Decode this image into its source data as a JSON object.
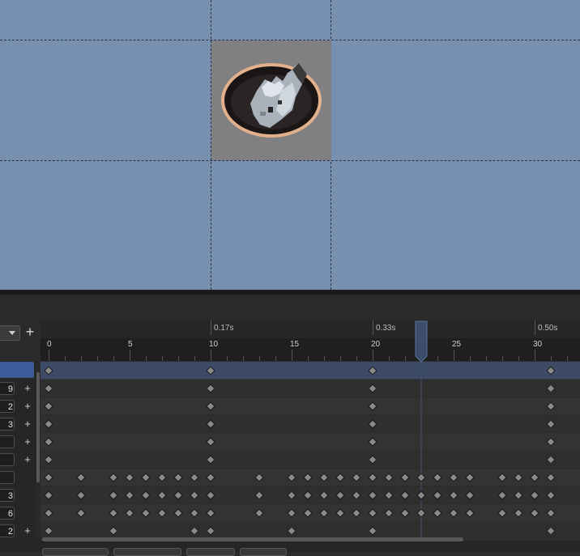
{
  "timeline": {
    "time_markers": [
      {
        "label": "0.17s",
        "frame": 10
      },
      {
        "label": "0.33s",
        "frame": 20
      },
      {
        "label": "0.50s",
        "frame": 30
      }
    ],
    "frame_ticks": [
      0,
      5,
      10,
      15,
      20,
      25,
      30
    ],
    "playhead_frame": 23,
    "rows": [
      {
        "keys": [
          0,
          10,
          20,
          31
        ],
        "selected": true
      },
      {
        "keys": [
          0,
          10,
          20,
          31
        ]
      },
      {
        "keys": [
          0,
          10,
          20,
          31
        ]
      },
      {
        "keys": [
          0,
          10,
          20,
          31
        ]
      },
      {
        "keys": [
          0,
          10,
          20,
          31
        ]
      },
      {
        "keys": [
          0,
          10,
          20,
          31
        ]
      },
      {
        "keys": [
          0,
          2,
          4,
          5,
          6,
          7,
          8,
          9,
          10,
          13,
          15,
          16,
          17,
          18,
          19,
          20,
          21,
          22,
          23,
          24,
          25,
          26,
          28,
          29,
          30,
          31
        ]
      },
      {
        "keys": [
          0,
          2,
          4,
          5,
          6,
          7,
          8,
          9,
          10,
          13,
          15,
          16,
          17,
          18,
          19,
          20,
          21,
          22,
          23,
          24,
          25,
          26,
          28,
          29,
          30,
          31
        ]
      },
      {
        "keys": [
          0,
          2,
          4,
          5,
          6,
          7,
          8,
          9,
          10,
          13,
          15,
          16,
          17,
          18,
          19,
          20,
          21,
          22,
          23,
          24,
          25,
          26,
          28,
          29,
          30,
          31
        ]
      },
      {
        "keys": [
          0,
          4,
          9,
          10,
          15,
          20,
          31
        ]
      }
    ]
  },
  "tracks": [
    {
      "value": "",
      "plus": false,
      "selected": true
    },
    {
      "value": "9",
      "plus": true
    },
    {
      "value": "2",
      "plus": true
    },
    {
      "value": "3",
      "plus": true
    },
    {
      "value": "",
      "plus": true
    },
    {
      "value": "",
      "plus": true
    },
    {
      "value": "",
      "plus": false
    },
    {
      "value": "3",
      "plus": false
    },
    {
      "value": "6",
      "plus": false
    },
    {
      "value": "2",
      "plus": true
    }
  ],
  "toolbar": {
    "add_label": "+"
  },
  "colors": {
    "viewport_bg": "#7890b0",
    "sprite_bg": "#808080",
    "selected_row": "#3d4b66",
    "playhead": "#3c5070",
    "keyframe": "#8a8a8a"
  }
}
